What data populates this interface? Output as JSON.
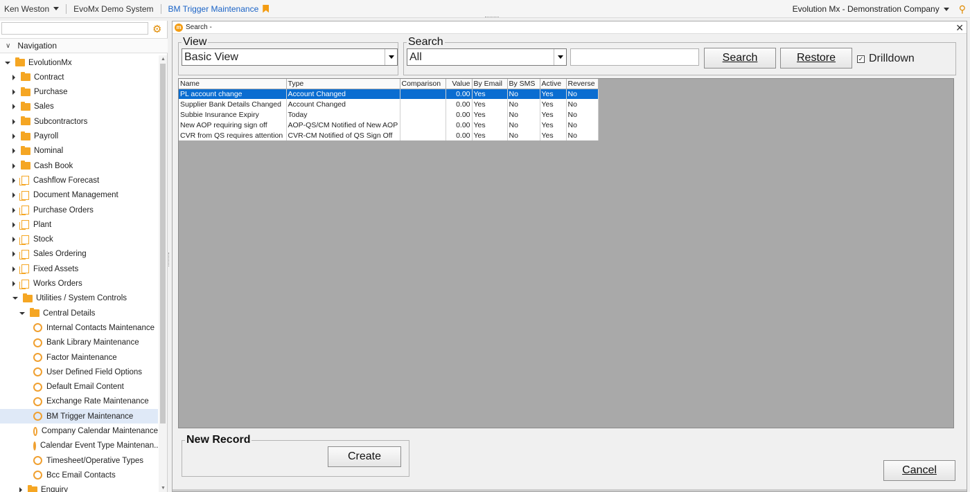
{
  "topbar": {
    "user": "Ken Weston",
    "system": "EvoMx Demo System",
    "page": "BM Trigger Maintenance",
    "company": "Evolution Mx - Demonstration Company"
  },
  "nav": {
    "header": "Navigation",
    "root": "EvolutionMx",
    "items": [
      "Contract",
      "Purchase",
      "Sales",
      "Subcontractors",
      "Payroll",
      "Nominal",
      "Cash Book",
      "Cashflow Forecast",
      "Document Management",
      "Purchase Orders",
      "Plant",
      "Stock",
      "Sales Ordering",
      "Fixed Assets",
      "Works Orders",
      "Utilities / System Controls"
    ],
    "central": "Central Details",
    "children": [
      "Internal Contacts Maintenance",
      "Bank Library Maintenance",
      "Factor Maintenance",
      "User Defined Field Options",
      "Default Email Content",
      "Exchange Rate Maintenance",
      "BM Trigger Maintenance",
      "Company Calendar Maintenance",
      "Calendar Event Type Maintenan...",
      "Timesheet/Operative Types",
      "Bcc Email Contacts"
    ],
    "last": "Enquiry"
  },
  "window": {
    "title": "Search -",
    "view_legend": "View",
    "view_value": "Basic View",
    "search_legend": "Search",
    "search_value": "All",
    "search_button": "Search",
    "restore_button": "Restore",
    "drilldown_label": "Drilldown",
    "new_record_legend": "New Record",
    "create_button": "Create",
    "cancel_button": "Cancel"
  },
  "grid": {
    "columns": [
      "Name",
      "Type",
      "Comparison",
      "Value",
      "By Email",
      "By SMS",
      "Active",
      "Reverse"
    ],
    "rows": [
      [
        "PL account change",
        "Account Changed",
        "",
        "0.00",
        "Yes",
        "No",
        "Yes",
        "No"
      ],
      [
        "Supplier Bank Details Changed",
        "Account Changed",
        "",
        "0.00",
        "Yes",
        "No",
        "Yes",
        "No"
      ],
      [
        "Subbie Insurance Expiry",
        "Today",
        "",
        "0.00",
        "Yes",
        "No",
        "Yes",
        "No"
      ],
      [
        "New AOP requiring sign off",
        "AOP-QS/CM Notified of New AOP",
        "",
        "0.00",
        "Yes",
        "No",
        "Yes",
        "No"
      ],
      [
        "CVR from QS requires attention",
        "CVR-CM Notified of QS Sign Off",
        "",
        "0.00",
        "Yes",
        "No",
        "Yes",
        "No"
      ]
    ]
  }
}
